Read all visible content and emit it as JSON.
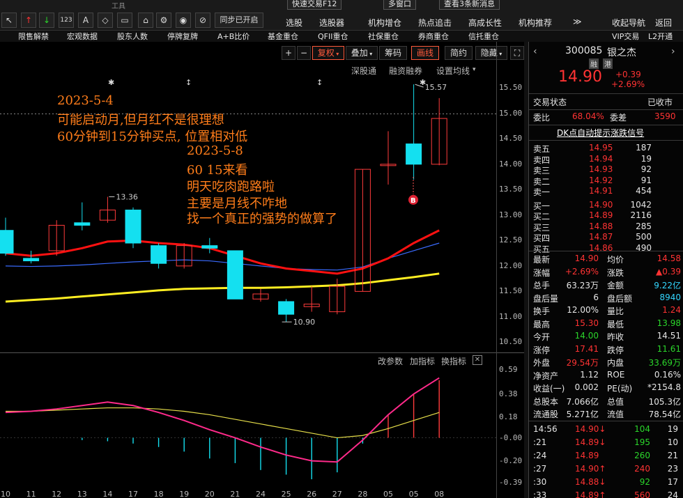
{
  "topbar": {
    "title_hint": "工具",
    "fast_trade": "快速交易F12",
    "multi_screen": "多窗口",
    "messages": "查看3条新消息",
    "sync_btn": "同步已开启",
    "menus_row1": [
      "选股",
      "选股器",
      "机构增仓",
      "热点追击",
      "高成长性",
      "机构推荐",
      "收起导航",
      "返回"
    ],
    "menus_row2": [
      "限售解禁",
      "宏观数据",
      "股东人数",
      "停牌复牌",
      "A+B比价",
      "基金重仓",
      "QFII重仓",
      "社保重仓",
      "券商重仓",
      "信托重仓",
      "VIP交易",
      "L2开通"
    ]
  },
  "chart_toolbar": {
    "plus": "+",
    "minus": "−",
    "fuquan": "复权",
    "overlay": "叠加",
    "chips": "筹码",
    "draw": "画线",
    "simple": "简约",
    "hide": "隐藏"
  },
  "sublinks": [
    "深股通",
    "融资融券",
    "设置均线"
  ],
  "indicator_links": [
    "改参数",
    "加指标",
    "换指标"
  ],
  "price_axis": [
    "15.50",
    "15.00",
    "14.50",
    "14.00",
    "13.50",
    "13.00",
    "12.50",
    "12.00",
    "11.50",
    "11.00",
    "10.50"
  ],
  "ind_axis": [
    "0.59",
    "0.38",
    "0.18",
    "-0.00",
    "-0.20",
    "-0.39"
  ],
  "dates": [
    "10",
    "11",
    "12",
    "13",
    "14",
    "17",
    "18",
    "19",
    "20",
    "21",
    "24",
    "25",
    "26",
    "27",
    "28",
    "05",
    "05",
    "08"
  ],
  "markers": {
    "high": "15.57",
    "mid_high": "13.36",
    "low": "10.90",
    "buy_signal": "B"
  },
  "annotations": [
    "2023-5-4",
    "可能启动月,但月红不是很理想",
    "60分钟到15分钟买点, 位置相对低",
    "2023-5-8",
    "60 15来看",
    "明天吃肉跑路啦",
    "主要是月线不咋地",
    "找一个真正的强势的做算了"
  ],
  "quote": {
    "code": "300085",
    "name": "银之杰",
    "tag1": "融",
    "tag2": "港",
    "price": "14.90",
    "change": "+0.39",
    "change_pct": "+2.69%",
    "status_label": "交易状态",
    "status_value": "已收市",
    "weibi_label": "委比",
    "weibi_value": "68.04%",
    "weicha_label": "委差",
    "weicha_value": "3590",
    "dk_link": "DK点自动提示涨跌信号",
    "sells": [
      {
        "label": "卖五",
        "price": "14.95",
        "vol": "187"
      },
      {
        "label": "卖四",
        "price": "14.94",
        "vol": "19"
      },
      {
        "label": "卖三",
        "price": "14.93",
        "vol": "92"
      },
      {
        "label": "卖二",
        "price": "14.92",
        "vol": "91"
      },
      {
        "label": "卖一",
        "price": "14.91",
        "vol": "454"
      }
    ],
    "buys": [
      {
        "label": "买一",
        "price": "14.90",
        "vol": "1042"
      },
      {
        "label": "买二",
        "price": "14.89",
        "vol": "2116"
      },
      {
        "label": "买三",
        "price": "14.88",
        "vol": "285"
      },
      {
        "label": "买四",
        "price": "14.87",
        "vol": "500"
      },
      {
        "label": "买五",
        "price": "14.86",
        "vol": "490"
      }
    ],
    "stats": [
      {
        "l1": "最新",
        "v1": "14.90",
        "c1": "red",
        "l2": "均价",
        "v2": "14.58",
        "c2": "red"
      },
      {
        "l1": "涨幅",
        "v1": "+2.69%",
        "c1": "red",
        "l2": "涨跌",
        "v2": "▲0.39",
        "c2": "red"
      },
      {
        "l1": "总手",
        "v1": "63.23万",
        "c1": "white",
        "l2": "金额",
        "v2": "9.22亿",
        "c2": "cyan"
      },
      {
        "l1": "盘后量",
        "v1": "6",
        "c1": "white",
        "l2": "盘后额",
        "v2": "8940",
        "c2": "cyan"
      },
      {
        "l1": "换手",
        "v1": "12.00%",
        "c1": "white",
        "l2": "量比",
        "v2": "1.24",
        "c2": "red"
      },
      {
        "l1": "最高",
        "v1": "15.30",
        "c1": "red",
        "l2": "最低",
        "v2": "13.98",
        "c2": "green"
      },
      {
        "l1": "今开",
        "v1": "14.00",
        "c1": "green",
        "l2": "昨收",
        "v2": "14.51",
        "c2": "white"
      },
      {
        "l1": "涨停",
        "v1": "17.41",
        "c1": "red",
        "l2": "跌停",
        "v2": "11.61",
        "c2": "green"
      },
      {
        "l1": "外盘",
        "v1": "29.54万",
        "c1": "red",
        "l2": "内盘",
        "v2": "33.69万",
        "c2": "green"
      },
      {
        "l1": "净资产",
        "v1": "1.12",
        "c1": "white",
        "l2": "ROE",
        "v2": "0.16%",
        "c2": "white"
      },
      {
        "l1": "收益(一)",
        "v1": "0.002",
        "c1": "white",
        "l2": "PE(动)",
        "v2": "*2154.8",
        "c2": "white"
      },
      {
        "l1": "总股本",
        "v1": "7.066亿",
        "c1": "white",
        "l2": "总值",
        "v2": "105.3亿",
        "c2": "white"
      },
      {
        "l1": "流通股",
        "v1": "5.271亿",
        "c1": "white",
        "l2": "流值",
        "v2": "78.54亿",
        "c2": "white"
      }
    ],
    "ticks": [
      {
        "time": "14:56",
        "price": "14.90↓",
        "pc": "red",
        "vol": "104",
        "vc": "green",
        "n": "19"
      },
      {
        "time": ":21",
        "price": "14.89↓",
        "pc": "red",
        "vol": "195",
        "vc": "green",
        "n": "10"
      },
      {
        "time": ":24",
        "price": "14.89",
        "pc": "red",
        "vol": "260",
        "vc": "green",
        "n": "21"
      },
      {
        "time": ":27",
        "price": "14.90↑",
        "pc": "red",
        "vol": "240",
        "vc": "red",
        "n": "23"
      },
      {
        "time": ":30",
        "price": "14.88↓",
        "pc": "red",
        "vol": "92",
        "vc": "green",
        "n": "17"
      },
      {
        "time": ":33",
        "price": "14.89↑",
        "pc": "red",
        "vol": "560",
        "vc": "red",
        "n": "24"
      }
    ]
  },
  "chart_data": {
    "type": "candlestick",
    "categories": [
      "10",
      "11",
      "12",
      "13",
      "14",
      "17",
      "18",
      "19",
      "20",
      "21",
      "24",
      "25",
      "26",
      "27",
      "28",
      "05",
      "05",
      "08"
    ],
    "ohlc": [
      {
        "o": 12.7,
        "h": 12.95,
        "l": 12.2,
        "c": 12.25
      },
      {
        "o": 12.15,
        "h": 12.3,
        "l": 12.05,
        "c": 12.1
      },
      {
        "o": 12.3,
        "h": 12.9,
        "l": 12.2,
        "c": 12.8
      },
      {
        "o": 12.85,
        "h": 13.25,
        "l": 12.7,
        "c": 12.8
      },
      {
        "o": 12.9,
        "h": 13.36,
        "l": 12.85,
        "c": 13.1
      },
      {
        "o": 13.1,
        "h": 13.15,
        "l": 12.35,
        "c": 12.45
      },
      {
        "o": 12.4,
        "h": 12.45,
        "l": 11.95,
        "c": 12.05
      },
      {
        "o": 12.0,
        "h": 12.45,
        "l": 11.95,
        "c": 12.4
      },
      {
        "o": 12.4,
        "h": 12.55,
        "l": 12.25,
        "c": 12.35
      },
      {
        "o": 12.3,
        "h": 12.3,
        "l": 11.35,
        "c": 11.35
      },
      {
        "o": 11.35,
        "h": 11.55,
        "l": 11.3,
        "c": 11.45
      },
      {
        "o": 11.3,
        "h": 11.35,
        "l": 10.9,
        "c": 11.05
      },
      {
        "o": 11.2,
        "h": 11.6,
        "l": 11.1,
        "c": 11.25
      },
      {
        "o": 11.1,
        "h": 11.75,
        "l": 11.05,
        "c": 11.6
      },
      {
        "o": 11.5,
        "h": 13.9,
        "l": 11.5,
        "c": 13.9
      },
      {
        "o": 14.0,
        "h": 14.65,
        "l": 13.6,
        "c": 14.0
      },
      {
        "o": 14.4,
        "h": 15.57,
        "l": 13.7,
        "c": 14.0
      },
      {
        "o": 14.0,
        "h": 15.3,
        "l": 13.98,
        "c": 14.9
      }
    ],
    "ma_red": [
      12.25,
      12.2,
      12.25,
      12.35,
      12.48,
      12.5,
      12.45,
      12.42,
      12.35,
      12.2,
      12.05,
      11.95,
      11.9,
      11.85,
      11.95,
      12.15,
      12.45,
      12.7
    ],
    "ma_blue": [
      12.0,
      11.99,
      12.0,
      12.02,
      12.05,
      12.08,
      12.1,
      12.12,
      12.1,
      12.05,
      12.0,
      11.95,
      11.93,
      11.92,
      11.98,
      12.15,
      12.3,
      12.45
    ],
    "ma_yellow": [
      11.3,
      11.33,
      11.36,
      11.4,
      11.44,
      11.48,
      11.52,
      11.55,
      11.56,
      11.57,
      11.57,
      11.58,
      11.6,
      11.62,
      11.66,
      11.72,
      11.78,
      11.85
    ],
    "ylim": [
      10.3,
      15.75
    ],
    "indicator": {
      "macd_bars": [
        0.0,
        0.0,
        0.0,
        -0.02,
        -0.03,
        -0.05,
        -0.08,
        -0.12,
        -0.18,
        -0.22,
        -0.28,
        -0.32,
        -0.36,
        -0.3,
        -0.05,
        0.2,
        0.38,
        0.5
      ],
      "dif": [
        0.22,
        0.23,
        0.25,
        0.28,
        0.31,
        0.28,
        0.22,
        0.15,
        0.07,
        0.0,
        -0.08,
        -0.15,
        -0.2,
        -0.21,
        -0.02,
        0.2,
        0.38,
        0.52
      ],
      "dea": [
        0.23,
        0.23,
        0.24,
        0.25,
        0.26,
        0.26,
        0.25,
        0.23,
        0.2,
        0.16,
        0.12,
        0.08,
        0.04,
        0.0,
        0.02,
        0.08,
        0.15,
        0.22
      ],
      "ylim": [
        -0.42,
        0.62
      ]
    }
  }
}
